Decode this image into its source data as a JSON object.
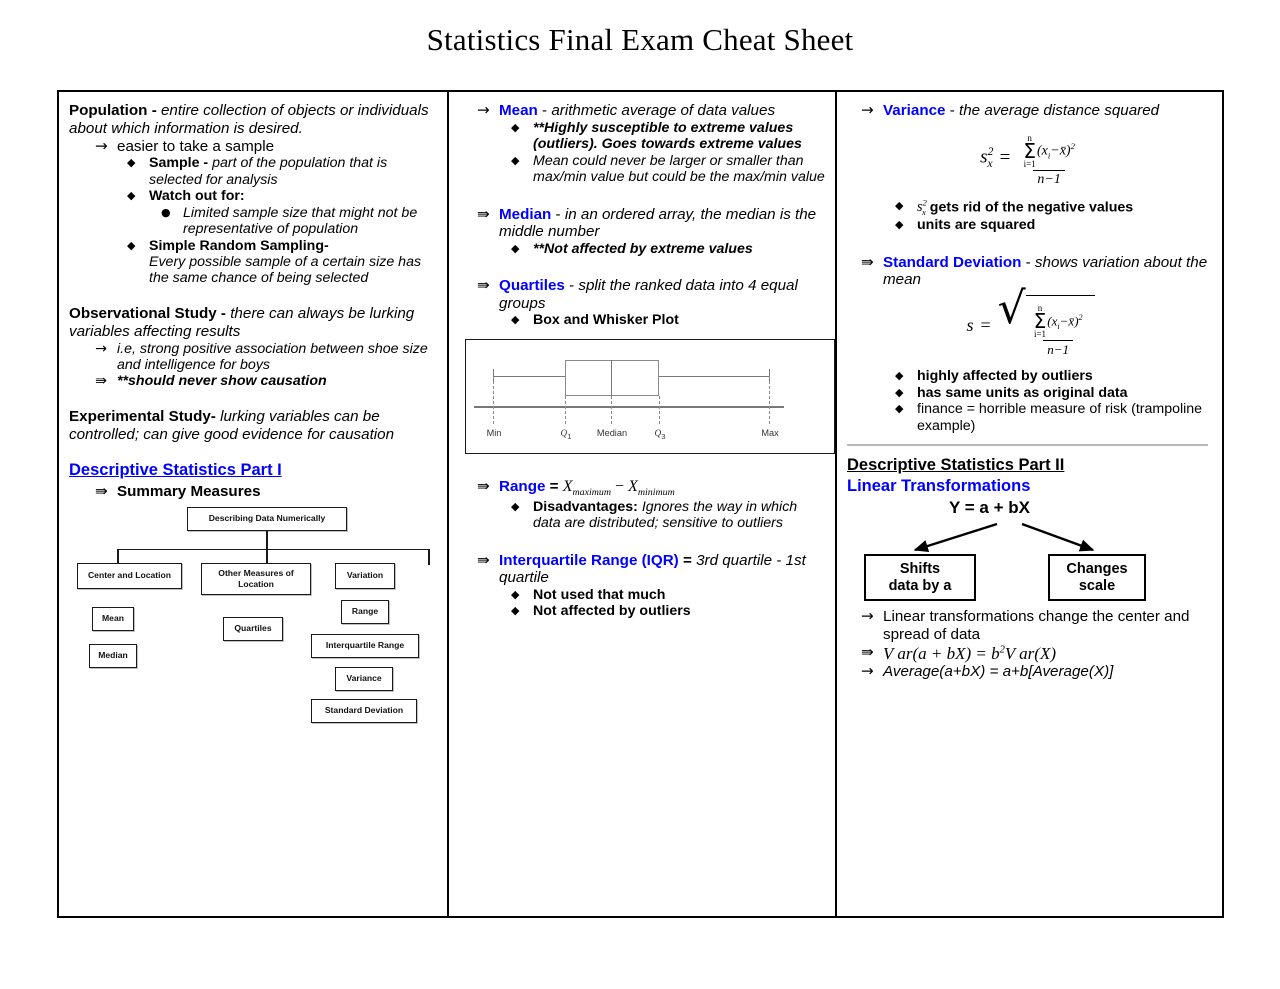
{
  "document": {
    "title": "Statistics Final Exam Cheat Sheet"
  },
  "column1": {
    "population": {
      "term": "Population",
      "dash": " - ",
      "definition": "entire collection of objects or individuals about which information is desired.",
      "point1": "easier to take a sample",
      "sample_term": "Sample",
      "sample_dash": " - ",
      "sample_def": "part of the population that is selected for analysis",
      "watch_out": "Watch out for:",
      "limited": "Limited sample size that might not be representative of population",
      "srs_term": "Simple Random Sampling-",
      "srs_def": "Every possible sample of a certain size has the same chance of being selected"
    },
    "observational": {
      "term": "Observational Study",
      "dash": " - ",
      "definition": "there can always be lurking variables affecting results",
      "point1": "i.e, strong positive association between shoe size and intelligence for boys",
      "point2": "**should never show causation"
    },
    "experimental": {
      "term": "Experimental Study-",
      "definition": " lurking variables can be controlled; can give good evidence for causation"
    },
    "descriptive_part1": {
      "heading": "Descriptive Statistics Part I",
      "point1": "Summary Measures"
    },
    "flowchart": {
      "root": "Describing Data Numerically",
      "branch1": "Center and Location",
      "branch2": "Other Measures of Location",
      "branch3": "Variation",
      "leaf_mean": "Mean",
      "leaf_median": "Median",
      "leaf_quartiles": "Quartiles",
      "leaf_range": "Range",
      "leaf_iqr": "Interquartile Range",
      "leaf_variance": "Variance",
      "leaf_stdev": "Standard Deviation"
    }
  },
  "column2": {
    "mean": {
      "term": "Mean",
      "dash": " - ",
      "definition": "arithmetic average of data values",
      "bullet1": "**Highly susceptible to extreme values (outliers). Goes towards extreme values",
      "bullet2": "Mean could never be larger or smaller than max/min value but could be the max/min value"
    },
    "median": {
      "term": "Median",
      "dash": " - ",
      "definition": "in an ordered array, the median is the middle number",
      "bullet1": "**Not affected by extreme values"
    },
    "quartiles": {
      "term": "Quartiles",
      "dash": " - ",
      "definition": "split the ranked data into 4 equal groups",
      "bullet1": "Box and Whisker Plot"
    },
    "boxplot": {
      "label_min": "Min",
      "label_q1_base": "Q",
      "label_q1_sub": "1",
      "label_median": "Median",
      "label_q3_base": "Q",
      "label_q3_sub": "3",
      "label_max": "Max"
    },
    "range": {
      "term": "Range",
      "equals": " = ",
      "formula_x1": "X",
      "formula_sub1": "maximum",
      "formula_minus": " − ",
      "formula_x2": "X",
      "formula_sub2": "minimum",
      "bullet1_bold": "Disadvantages:",
      "bullet1_text": " Ignores the way in which data are distributed; sensitive to outliers"
    },
    "iqr": {
      "term": "Interquartile Range (IQR)",
      "equals": " = ",
      "definition": "3rd quartile - 1st quartile",
      "bullet1": "Not used that much",
      "bullet2": "Not affected by outliers"
    }
  },
  "column3": {
    "variance": {
      "term": "Variance",
      "dash": " - ",
      "definition": "the average distance squared",
      "formula": {
        "lhs_s": "s",
        "lhs_sup": "2",
        "lhs_sub": "x",
        "equals": "=",
        "sum_upper": "n",
        "sum_lower": "i=1",
        "numerator": "(x",
        "numerator_sub": "i",
        "numerator_mid": "−x̄)",
        "numerator_sup": "2",
        "denominator": "n−1"
      },
      "bullet1_math_s": "s",
      "bullet1_math_sup": "2",
      "bullet1_math_sub": "x",
      "bullet1_text": " gets rid of the negative values",
      "bullet2": "units are squared"
    },
    "stdev": {
      "term": "Standard Deviation",
      "dash": " - ",
      "definition": "shows variation about the mean",
      "formula": {
        "lhs_s": "s",
        "equals": "=",
        "sum_upper": "n",
        "sum_lower": "i=1",
        "numerator": "(x",
        "numerator_sub": "i",
        "numerator_mid": "−x̄)",
        "numerator_sup": "2",
        "denominator": "n−1"
      },
      "bullet1": "highly affected by outliers",
      "bullet2": "has same units as original data",
      "bullet3": "finance = horrible measure of risk (trampoline example)"
    },
    "descriptive_part2": {
      "heading": "Descriptive Statistics Part II",
      "subheading": "Linear Transformations",
      "equation": "Y = a + bX",
      "box_left": "Shifts\ndata by a",
      "box_left_line1": "Shifts",
      "box_left_line2": "data by a",
      "box_right_line1": "Changes",
      "box_right_line2": "scale",
      "point1": "Linear transformations change the center and spread of data",
      "point2_var": "V ar(a + bX) = b",
      "point2_sup": "2",
      "point2_tail": "V ar(X)",
      "point3": "Average(a+bX) = a+b[Average(X)]"
    }
  },
  "colors": {
    "heading_blue": "#0000FF",
    "text_black": "#000000",
    "border": "#000000",
    "diagram_grey": "#888888"
  },
  "icons": {
    "arrow_single": "→",
    "arrow_double": "⇛",
    "diamond": "◆",
    "dot": "●"
  }
}
